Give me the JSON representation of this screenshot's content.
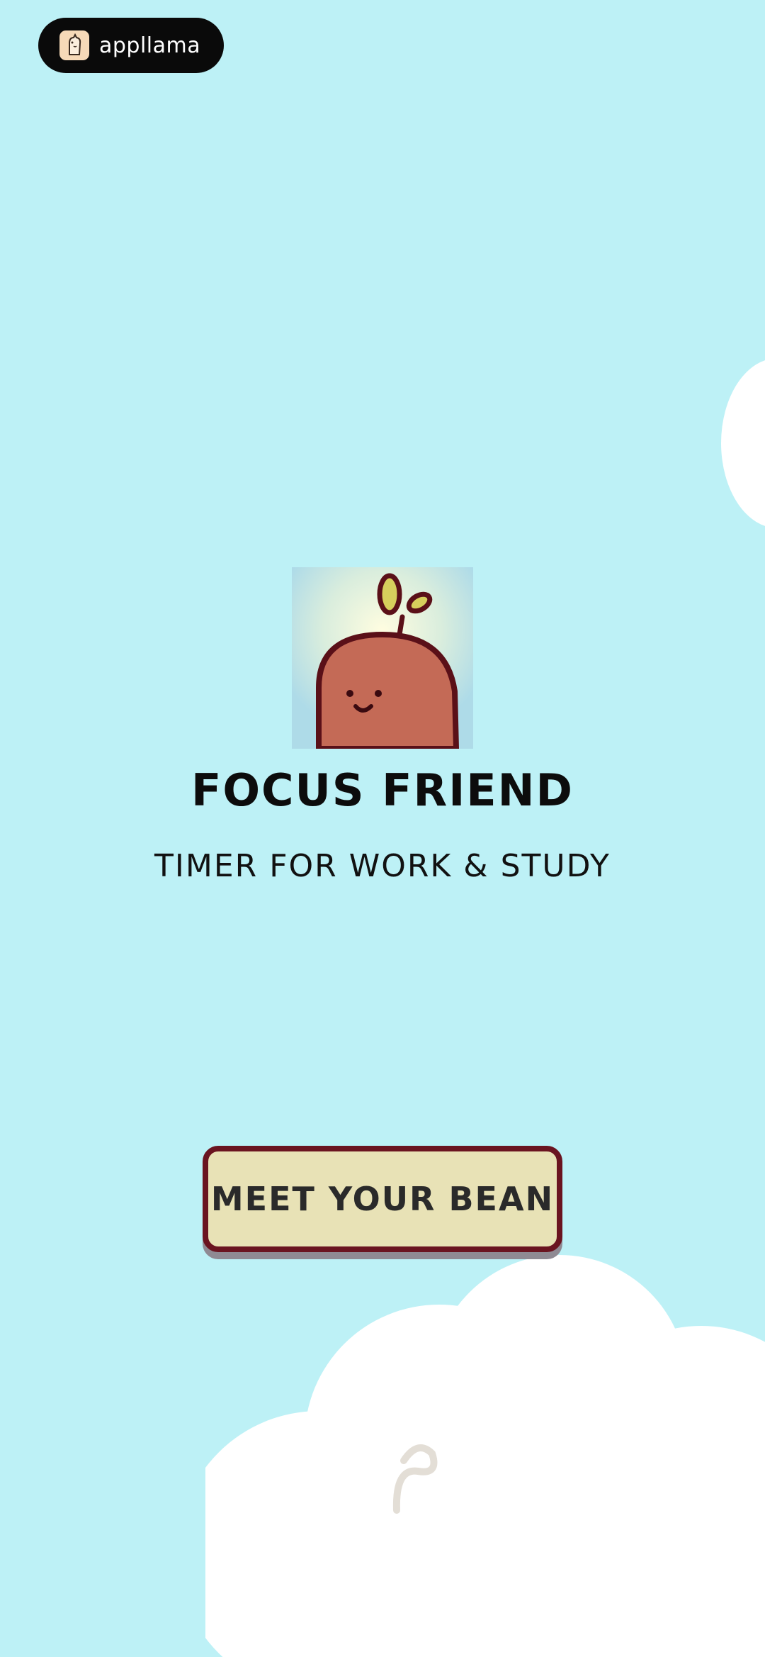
{
  "badge": {
    "brand": "appllama",
    "icon": "llama-icon"
  },
  "hero": {
    "title": "FOCUS FRIEND",
    "subtitle": "TIMER FOR WORK & STUDY",
    "mascot": "bean-mascot-icon"
  },
  "cta": {
    "label": "MEET YOUR BEAN"
  },
  "colors": {
    "background": "#bdf1f6",
    "button_fill": "#e8e2b6",
    "button_border": "#6a1420",
    "bean": "#c46a56",
    "badge": "#0a0a0a"
  }
}
